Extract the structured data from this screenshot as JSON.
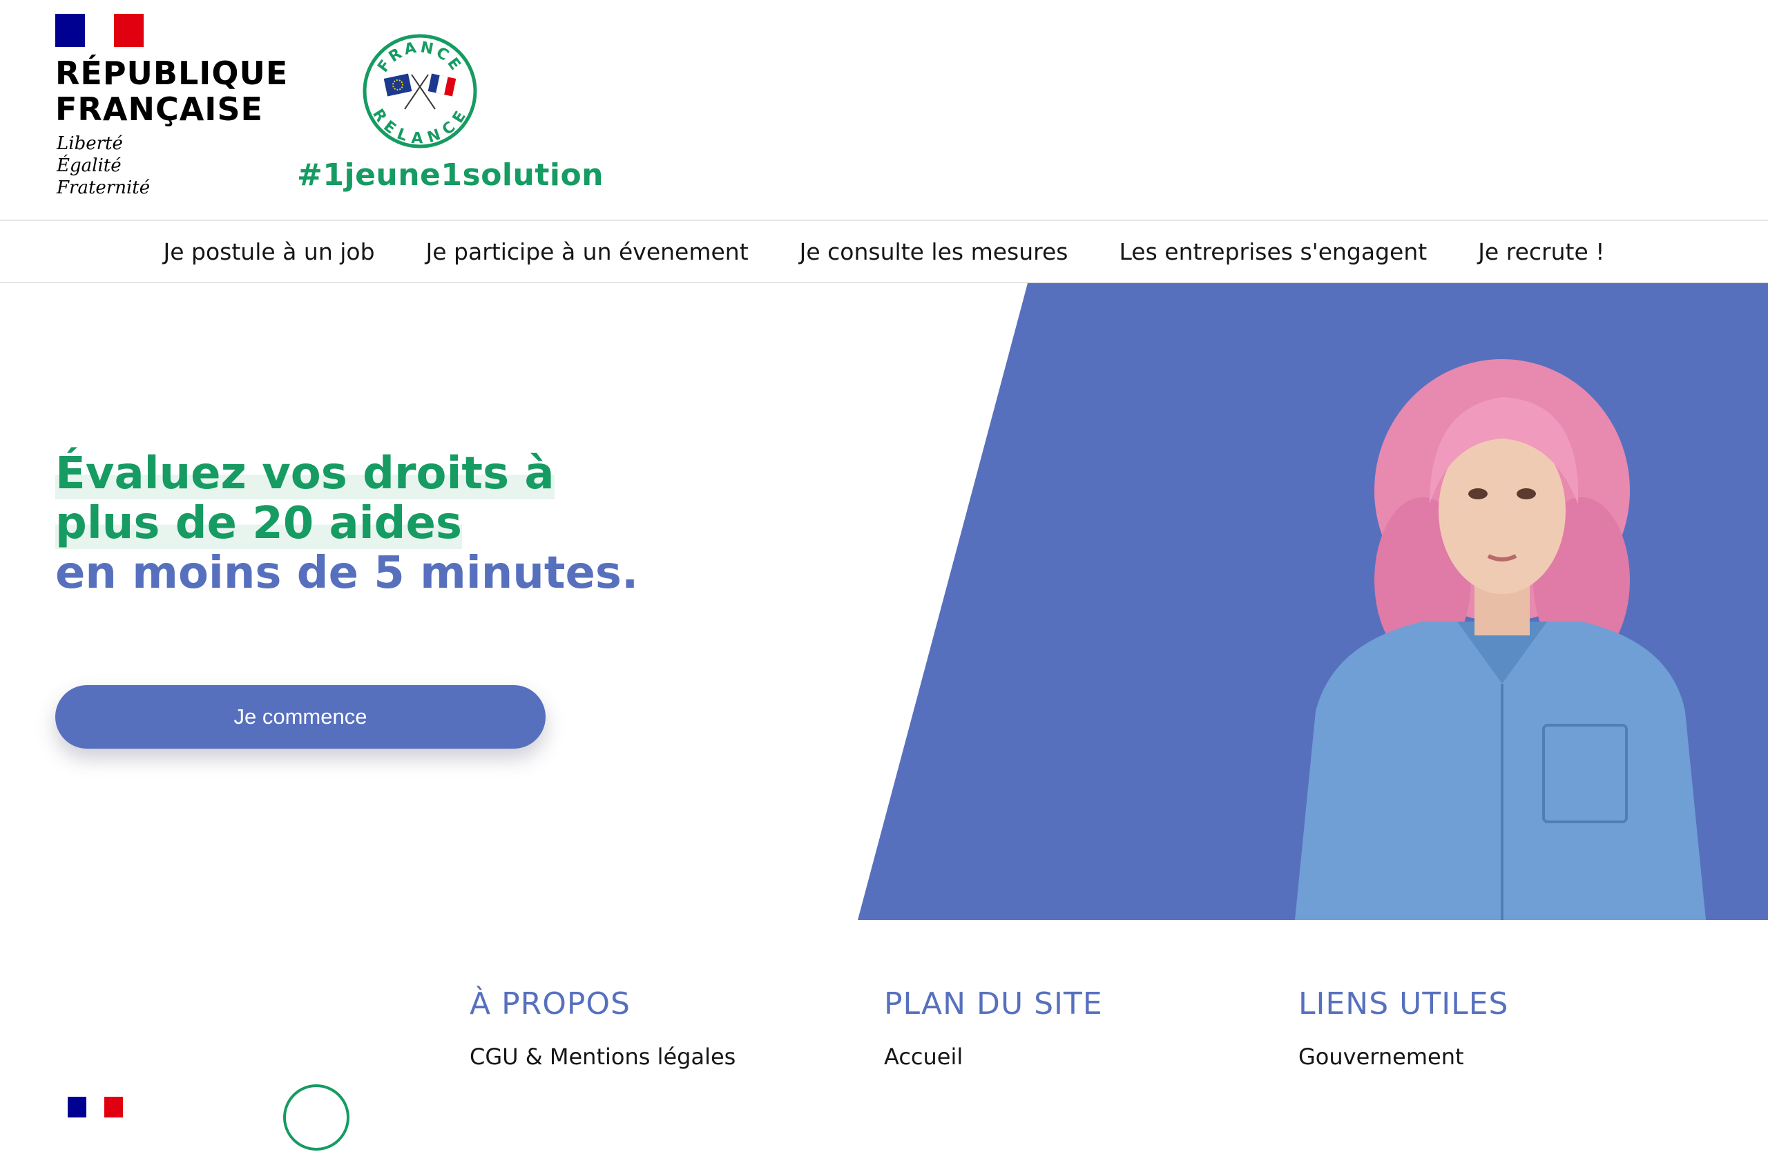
{
  "header": {
    "republique": {
      "line1": "RÉPUBLIQUE",
      "line2": "FRANÇAISE",
      "motto": [
        "Liberté",
        "Égalité",
        "Fraternité"
      ]
    },
    "france_relance": {
      "seal_top": "FRANCE",
      "seal_bottom": "RELANCE",
      "hashtag": "#1jeune1solution"
    }
  },
  "nav": {
    "items": [
      "Je postule à un job",
      "Je participe à un évenement",
      "Je consulte les mesures",
      "Les entreprises s'engagent",
      "Je recrute !"
    ]
  },
  "hero": {
    "title_line1": "Évaluez vos droits à",
    "title_line2": "plus de 20 aides",
    "title_line3": "en moins de 5 minutes.",
    "cta_label": "Je commence",
    "colors": {
      "green": "#169b62",
      "blue": "#5770be"
    }
  },
  "footer": {
    "columns": [
      {
        "title": "À PROPOS",
        "links": [
          "CGU & Mentions légales"
        ]
      },
      {
        "title": "PLAN DU SITE",
        "links": [
          "Accueil"
        ]
      },
      {
        "title": "LIENS UTILES",
        "links": [
          "Gouvernement"
        ]
      }
    ]
  }
}
